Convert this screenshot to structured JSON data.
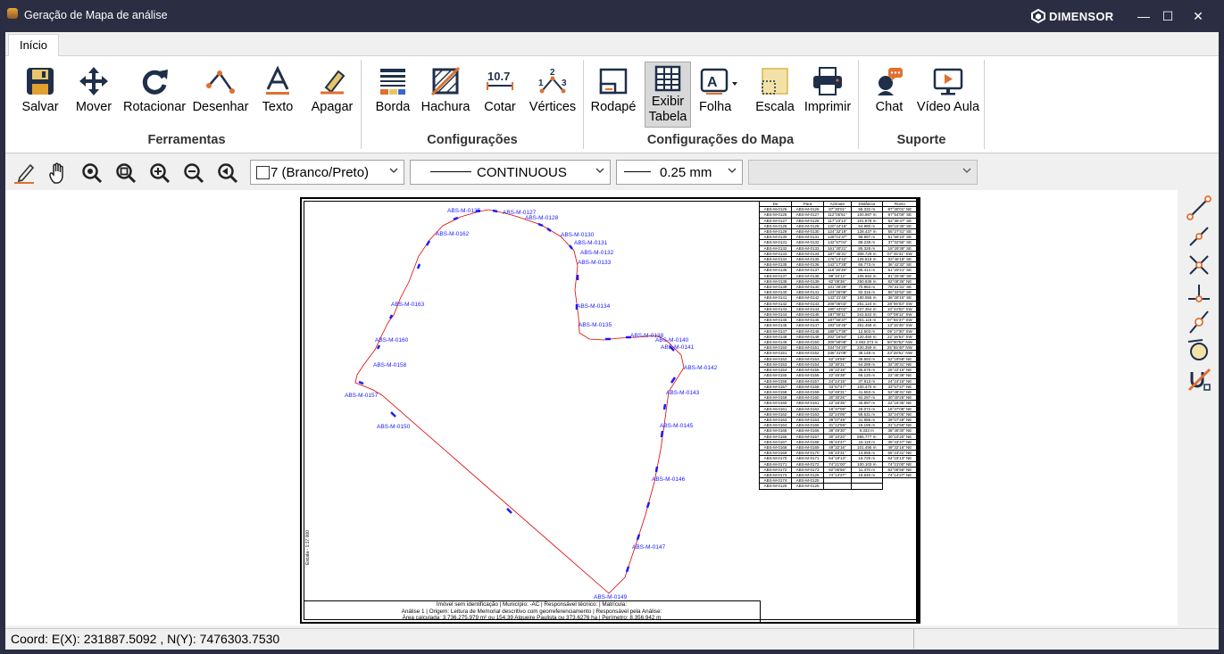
{
  "window": {
    "title": "Geração de Mapa de análise",
    "brand": "DIMENSOR",
    "min": "—",
    "max": "☐",
    "close": "✕"
  },
  "tabs": [
    {
      "label": "Início"
    }
  ],
  "ribbon": {
    "buttons": [
      {
        "label": "Salvar",
        "icon": "save-icon"
      },
      {
        "label": "Mover",
        "icon": "move-icon"
      },
      {
        "label": "Rotacionar",
        "icon": "rotate-icon"
      },
      {
        "label": "Desenhar",
        "icon": "draw-icon"
      },
      {
        "label": "Texto",
        "icon": "text-icon"
      },
      {
        "label": "Apagar",
        "icon": "eraser-icon"
      },
      {
        "label": "Borda",
        "icon": "border-icon"
      },
      {
        "label": "Hachura",
        "icon": "hatch-icon"
      },
      {
        "label": "Cotar",
        "icon": "dimension-icon"
      },
      {
        "label": "Vértices",
        "icon": "vertices-icon"
      },
      {
        "label": "Rodapé",
        "icon": "footer-icon"
      },
      {
        "label": "Exibir Tabela",
        "label1": "Exibir",
        "label2": "Tabela",
        "icon": "table-icon"
      },
      {
        "label": "Folha",
        "icon": "sheet-icon"
      },
      {
        "label": "Escala",
        "icon": "scale-icon"
      },
      {
        "label": "Imprimir",
        "icon": "printer-icon"
      },
      {
        "label": "Chat",
        "icon": "chat-icon"
      },
      {
        "label": "Vídeo Aula",
        "icon": "video-icon"
      }
    ],
    "groups": [
      "Ferramentas",
      "Configurações",
      "Configurações do Mapa",
      "Suporte"
    ]
  },
  "toolbar": {
    "color_select": "7 (Branco/Preto)",
    "linetype_select": "CONTINUOUS",
    "lineweight_select": "0.25 mm",
    "layer_select": ""
  },
  "map": {
    "vertex_labels": [
      "ABS-M-0125",
      "ABS-M-0127",
      "ABS-M-0128",
      "ABS-M-0130",
      "ABS-M-0131",
      "ABS-M-0132",
      "ABS-M-0133",
      "ABS-M-0134",
      "ABS-M-0135",
      "ABS-M-0138",
      "ABS-M-0140",
      "ABS-M-0141",
      "ABS-M-0142",
      "ABS-M-0143",
      "ABS-M-0145",
      "ABS-M-0146",
      "ABS-M-0147",
      "ABS-M-0149",
      "ABS-M-0150",
      "ABS-M-0157",
      "ABS-M-0160",
      "ABS-M-0162",
      "ABS-M-0163",
      "ABS-M-0158"
    ],
    "info_line1": "Imóvel sem identificação | Município: -AC | Responsável técnico: | Matrícula:",
    "info_line2": "Análise 1 | Origem: Leitura de Memorial descritivo com georreferenciamento | Responsável pela Análise:",
    "info_line3": "Área calculada: 3.736.275,979 m² ou 154,39 Alqueire Paulista ou 373,6276 ha | Perímetro: 8.356,942 m",
    "table_headers": [
      "De",
      "Para",
      "Azimute",
      "Distância",
      "Rumo"
    ],
    "table_rows": [
      [
        "ABS-M-0125",
        "ABS-M-0126",
        "87°30'01\"",
        "58.332 m",
        "87°30'01\" NE"
      ],
      [
        "ABS-M-0126",
        "ABS-M-0127",
        "112°05'51\"",
        "100.987 m",
        "67°54'09\" SE"
      ],
      [
        "ABS-M-0127",
        "ABS-M-0128",
        "117°23'13\"",
        "101.878 m",
        "62°36'47\" SE"
      ],
      [
        "ABS-M-0128",
        "ABS-M-0129",
        "120°44'15\"",
        "54.980 m",
        "59°15'45\" SE"
      ],
      [
        "ABS-M-0129",
        "ABS-M-0130",
        "124°32'19\"",
        "128.437 m",
        "55°27'41\" SE"
      ],
      [
        "ABS-M-0130",
        "ABS-M-0131",
        "128°01'37\"",
        "98.997 m",
        "51°58'23\" SE"
      ],
      [
        "ABS-M-0131",
        "ABS-M-0132",
        "142°57'04\"",
        "88.238 m",
        "37°02'56\" SE"
      ],
      [
        "ABS-M-0132",
        "ABS-M-0133",
        "161°30'21\"",
        "85.328 m",
        "18°29'39\" SE"
      ],
      [
        "ABS-M-0133",
        "ABS-M-0134",
        "187°45'31\"",
        "308.729 m",
        "07°45'31\" SW"
      ],
      [
        "ABS-M-0134",
        "ABS-M-0135",
        "176°13'42\"",
        "125.818 m",
        "03°46'18\" SE"
      ],
      [
        "ABS-M-0135",
        "ABS-M-0136",
        "143°17'28\"",
        "65.773 m",
        "36°42'32\" SE"
      ],
      [
        "ABS-M-0136",
        "ABS-M-0137",
        "118°30'39\"",
        "85.414 m",
        "61°29'21\" SE"
      ],
      [
        "ABS-M-0137",
        "ABS-M-0138",
        "98°34'12\"",
        "105.582 m",
        "81°25'48\" SE"
      ],
      [
        "ABS-M-0138",
        "ABS-M-0139",
        "82°08'36\"",
        "250.938 m",
        "82°08'36\" NE"
      ],
      [
        "ABS-M-0139",
        "ABS-M-0140",
        "101°28'29\"",
        "70.963 m",
        "78°31'31\" SE"
      ],
      [
        "ABS-M-0140",
        "ABS-M-0141",
        "123°26'08\"",
        "82.316 m",
        "56°33'52\" SE"
      ],
      [
        "ABS-M-0141",
        "ABS-M-0142",
        "143°31'45\"",
        "180.055 m",
        "36°28'15\" SE"
      ],
      [
        "ABS-M-0142",
        "ABS-M-0143",
        "208°06'03\"",
        "251.124 m",
        "28°06'03\" SW"
      ],
      [
        "ABS-M-0143",
        "ABS-M-0144",
        "190°43'02\"",
        "227.354 m",
        "10°43'02\" SW"
      ],
      [
        "ABS-M-0144",
        "ABS-M-0145",
        "187°08'11\"",
        "241.522 m",
        "07°08'11\" SW"
      ],
      [
        "ABS-M-0145",
        "ABS-M-0146",
        "187°55'37\"",
        "251.115 m",
        "07°55'37\" SW"
      ],
      [
        "ABS-M-0146",
        "ABS-M-0147",
        "193°16'45\"",
        "251.459 m",
        "13°16'45\" SW"
      ],
      [
        "ABS-M-0147",
        "ABS-M-0148",
        "189°17'30\"",
        "12.503 m",
        "09°17'30\" SW"
      ],
      [
        "ABS-M-0148",
        "ABS-M-0149",
        "202°16'54\"",
        "120.450 m",
        "22°16'54\" SW"
      ],
      [
        "ABS-M-0149",
        "ABS-M-0150",
        "309°59'08\"",
        "2.083.373 m",
        "50°00'52\" NW"
      ],
      [
        "ABS-M-0150",
        "ABS-M-0151",
        "334°04'20\"",
        "230.359 m",
        "25°55'40\" NW"
      ],
      [
        "ABS-M-0151",
        "ABS-M-0152",
        "336°31'09\"",
        "38.148 m",
        "23°28'51\" NW"
      ],
      [
        "ABS-M-0152",
        "ABS-M-0153",
        "62°19'59\"",
        "38.693 m",
        "62°19'59\" NE"
      ],
      [
        "ABS-M-0153",
        "ABS-M-0154",
        "32°30'31\"",
        "54.289 m",
        "32°30'31\" NE"
      ],
      [
        "ABS-M-0154",
        "ABS-M-0155",
        "26°22'16\"",
        "36.675 m",
        "26°22'16\" NE"
      ],
      [
        "ABS-M-0155",
        "ABS-M-0156",
        "22°45'38\"",
        "68.120 m",
        "22°45'38\" NE"
      ],
      [
        "ABS-M-0156",
        "ABS-M-0157",
        "24°24'15\"",
        "37.913 m",
        "24°24'15\" NE"
      ],
      [
        "ABS-M-0157",
        "ABS-M-0158",
        "33°57'47\"",
        "100.470 m",
        "33°57'47\" NE"
      ],
      [
        "ABS-M-0158",
        "ABS-M-0159",
        "52°48'31\"",
        "41.553 m",
        "52°48'31\" NE"
      ],
      [
        "ABS-M-0159",
        "ABS-M-0160",
        "30°30'26\"",
        "92.297 m",
        "30°30'26\" NE"
      ],
      [
        "ABS-M-0160",
        "ABS-M-0161",
        "22°16'35\"",
        "45.897 m",
        "22°16'35\" NE"
      ],
      [
        "ABS-M-0161",
        "ABS-M-0162",
        "18°37'08\"",
        "28.072 m",
        "18°37'08\" NE"
      ],
      [
        "ABS-M-0162",
        "ABS-M-0163",
        "32°24'05\"",
        "58.531 m",
        "32°24'05\" NE"
      ],
      [
        "ABS-M-0163",
        "ABS-M-0164",
        "39°07'49\"",
        "31.985 m",
        "39°07'49\" NE"
      ],
      [
        "ABS-M-0164",
        "ABS-M-0165",
        "31°12'59\"",
        "19.195 m",
        "31°12'59\" NE"
      ],
      [
        "ABS-M-0165",
        "ABS-M-0166",
        "38°49'30\"",
        "9.333 m",
        "38°49'30\" NE"
      ],
      [
        "ABS-M-0166",
        "ABS-M-0167",
        "30°10'20\"",
        "686.777 m",
        "30°10'20\" NE"
      ],
      [
        "ABS-M-0167",
        "ABS-M-0168",
        "35°43'47\"",
        "16.118 m",
        "35°43'47\" NE"
      ],
      [
        "ABS-M-0168",
        "ABS-M-0169",
        "49°32'16\"",
        "101.495 m",
        "49°32'16\" NE"
      ],
      [
        "ABS-M-0169",
        "ABS-M-0170",
        "65°23'31\"",
        "14.655 m",
        "65°23'31\" NE"
      ],
      [
        "ABS-M-0170",
        "ABS-M-0171",
        "64°19'13\"",
        "16.725 m",
        "64°19'13\" NE"
      ],
      [
        "ABS-M-0171",
        "ABS-M-0172",
        "74°21'00\"",
        "100.103 m",
        "74°21'00\" NE"
      ],
      [
        "ABS-M-0172",
        "ABS-M-0173",
        "82°06'56\"",
        "11.370 m",
        "82°06'56\" NE"
      ],
      [
        "ABS-M-0173",
        "ABS-M-0125",
        "74°14'27\"",
        "19.640 m",
        "74°14'27\" NE"
      ],
      [
        "ABS-M-0174",
        "ABS-M-0125",
        "",
        ""
      ],
      [
        "ABS-M-0125",
        "ABS-M-0125",
        "",
        ""
      ]
    ],
    "scale_label": "Escala - 1:17.000"
  },
  "status": {
    "coord": "Coord: E(X): 231887.5092 , N(Y): 7476303.7530"
  },
  "colors": {
    "titlebar": "#2b2d42",
    "polygon": "#e00000",
    "labels": "#1a1aff",
    "accent": "#e07030"
  }
}
